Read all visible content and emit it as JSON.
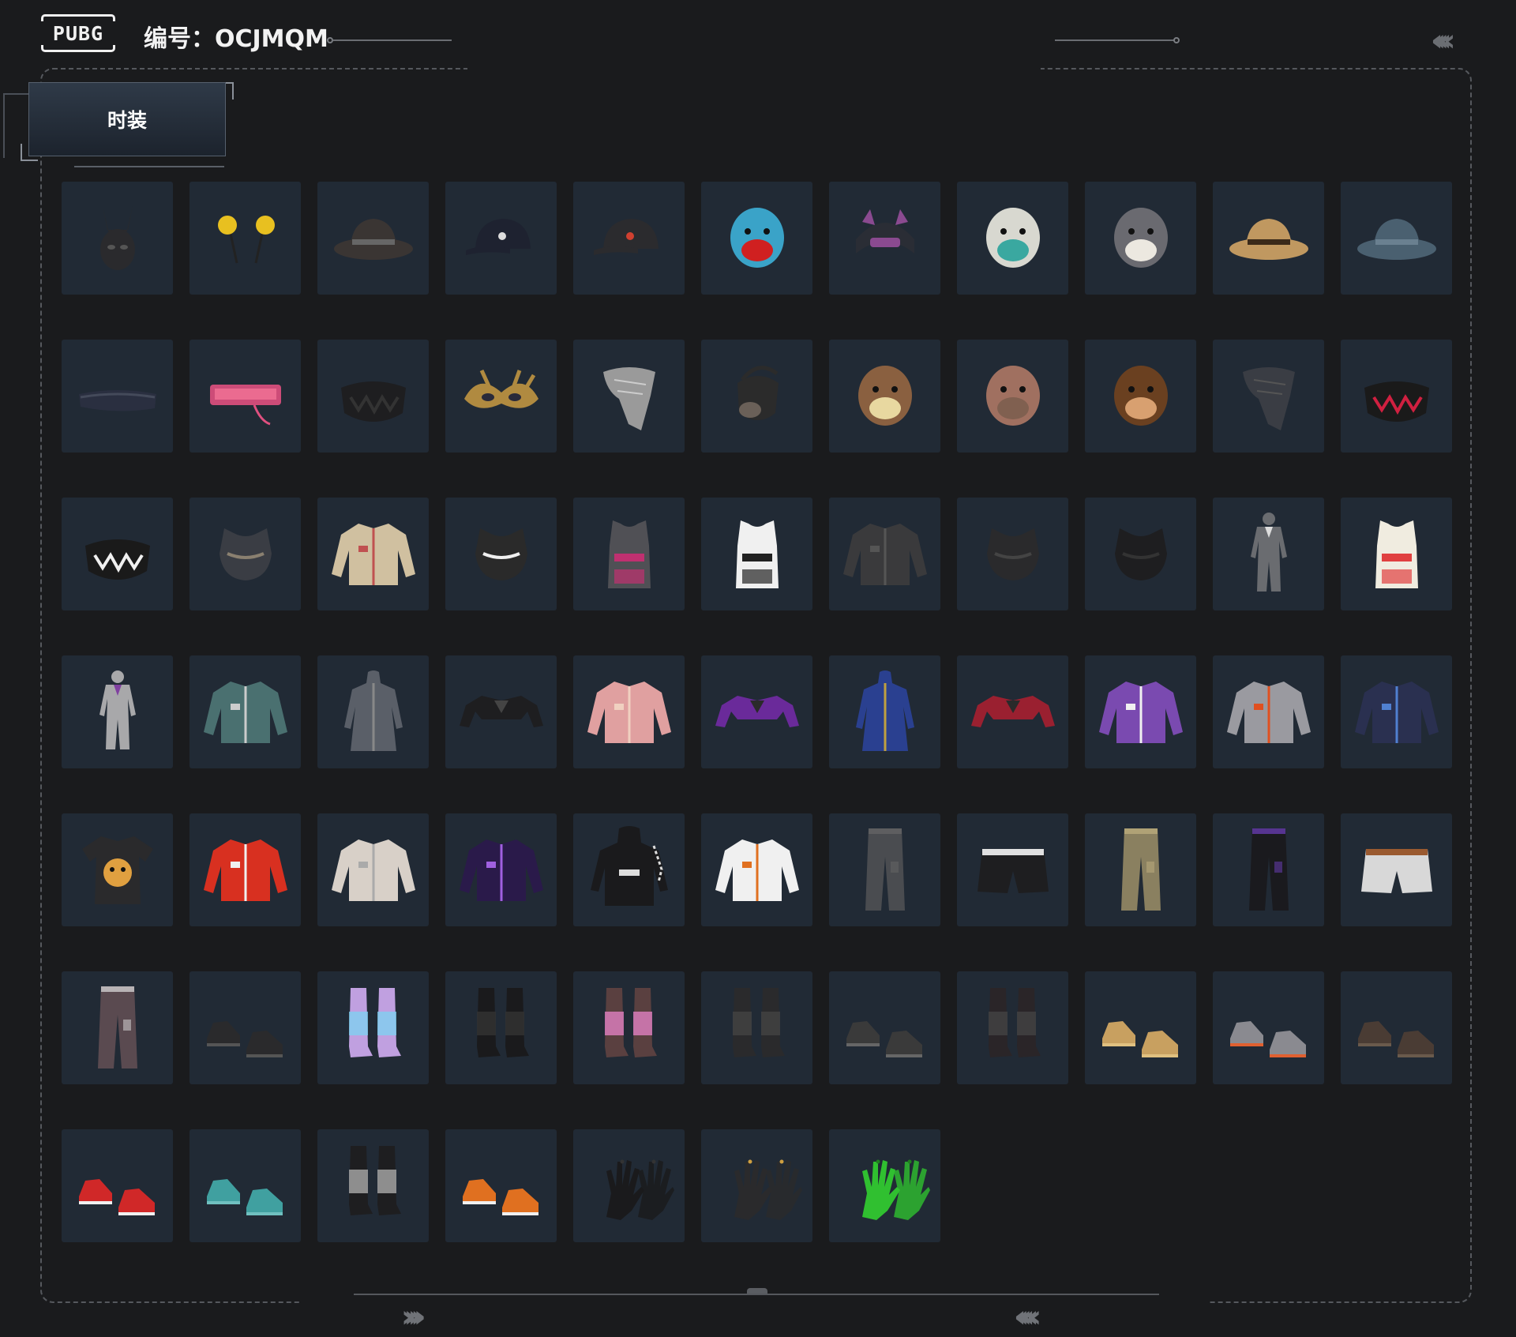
{
  "header": {
    "logo_text": "PUBG",
    "id_text": "编号：OCJMQM"
  },
  "tab": {
    "label": "时装"
  },
  "items": [
    {
      "icon": "bunny-mask-icon",
      "kind": "mask",
      "c": "#2a2a2d",
      "a": "#555"
    },
    {
      "icon": "pompom-antenna-icon",
      "kind": "antenna",
      "c": "#e8c020",
      "a": "#222"
    },
    {
      "icon": "cowboy-hat-icon",
      "kind": "hat",
      "c": "#3a3533",
      "a": "#666"
    },
    {
      "icon": "baseball-cap-icon",
      "kind": "cap",
      "c": "#1e2230",
      "a": "#ddd"
    },
    {
      "icon": "black-cap-icon",
      "kind": "cap",
      "c": "#2b2b2e",
      "a": "#d04030"
    },
    {
      "icon": "dino-head-icon",
      "kind": "head",
      "c": "#3aa3c8",
      "a": "#d02020"
    },
    {
      "icon": "cat-ear-headset-icon",
      "kind": "headset",
      "c": "#2a2d35",
      "a": "#8a4a90"
    },
    {
      "icon": "beard-mask-icon",
      "kind": "head",
      "c": "#d8d8d0",
      "a": "#3aa8a0"
    },
    {
      "icon": "husky-head-icon",
      "kind": "head",
      "c": "#6a6a70",
      "a": "#ece8e0"
    },
    {
      "icon": "bucket-hat-icon",
      "kind": "hat",
      "c": "#c09860",
      "a": "#3a2a1a"
    },
    {
      "icon": "fishing-hat-icon",
      "kind": "hat",
      "c": "#4a6070",
      "a": "#6a8090"
    },
    {
      "icon": "visor-icon",
      "kind": "visor",
      "c": "#2a2f40",
      "a": "#444a5a"
    },
    {
      "icon": "led-glasses-icon",
      "kind": "glasses",
      "c": "#e05080",
      "a": "#ff80a0"
    },
    {
      "icon": "face-mask-icon",
      "kind": "facemask",
      "c": "#1e1e20",
      "a": "#333"
    },
    {
      "icon": "gold-masquerade-icon",
      "kind": "masquerade",
      "c": "#b08a40",
      "a": "#2a2a3a"
    },
    {
      "icon": "scarf-icon",
      "kind": "scarf",
      "c": "#9a9a9a",
      "a": "#ccc"
    },
    {
      "icon": "gas-respirator-icon",
      "kind": "respirator",
      "c": "#2b2b2b",
      "a": "#6a6058"
    },
    {
      "icon": "rabbit-mask-icon",
      "kind": "head",
      "c": "#8a6040",
      "a": "#e8d8a0"
    },
    {
      "icon": "bald-head-icon",
      "kind": "head",
      "c": "#a07060",
      "a": "#806050"
    },
    {
      "icon": "monkey-mask-icon",
      "kind": "head",
      "c": "#6a4020",
      "a": "#d8a070"
    },
    {
      "icon": "bandana-icon",
      "kind": "scarf",
      "c": "#3a3d44",
      "a": "#555"
    },
    {
      "icon": "smile-mask-icon",
      "kind": "facemask",
      "c": "#1a1a1a",
      "a": "#d02040"
    },
    {
      "icon": "teeth-mask-icon",
      "kind": "facemask",
      "c": "#1a1a1a",
      "a": "#f0f0f0"
    },
    {
      "icon": "tactical-top-icon",
      "kind": "top",
      "c": "#3a3d44",
      "a": "#8a8070"
    },
    {
      "icon": "floral-shirt-icon",
      "kind": "jacket",
      "c": "#d0c0a0",
      "a": "#c05050"
    },
    {
      "icon": "halter-top-icon",
      "kind": "top",
      "c": "#2a2a2a",
      "a": "#f0f0f0"
    },
    {
      "icon": "tank-plaid-icon",
      "kind": "tank",
      "c": "#505055",
      "a": "#c03070"
    },
    {
      "icon": "white-vest-icon",
      "kind": "tank",
      "c": "#f0f0f0",
      "a": "#222"
    },
    {
      "icon": "leather-jacket-icon",
      "kind": "jacket",
      "c": "#3a3a3c",
      "a": "#555"
    },
    {
      "icon": "leather-top-icon",
      "kind": "top",
      "c": "#2a2a2c",
      "a": "#444"
    },
    {
      "icon": "strappy-top-icon",
      "kind": "top",
      "c": "#1e1e20",
      "a": "#333"
    },
    {
      "icon": "jumpsuit-icon",
      "kind": "suit",
      "c": "#6a6c70",
      "a": "#ddd"
    },
    {
      "icon": "sticker-dress-icon",
      "kind": "tank",
      "c": "#f0ece0",
      "a": "#e04040"
    },
    {
      "icon": "grey-suit-icon",
      "kind": "suit",
      "c": "#a8a8aa",
      "a": "#8040a0"
    },
    {
      "icon": "hawaiian-shirt-icon",
      "kind": "jacket",
      "c": "#4a7070",
      "a": "#ccc"
    },
    {
      "icon": "hooded-coat-icon",
      "kind": "coat",
      "c": "#5a5f68",
      "a": "#888"
    },
    {
      "icon": "black-crop-jacket-icon",
      "kind": "crop",
      "c": "#1e1e20",
      "a": "#444"
    },
    {
      "icon": "pink-jacket-icon",
      "kind": "jacket",
      "c": "#e0a0a0",
      "a": "#f0d0c0"
    },
    {
      "icon": "purple-crop-icon",
      "kind": "crop",
      "c": "#6a2a9a",
      "a": "#2a2a2a"
    },
    {
      "icon": "blue-coat-icon",
      "kind": "coat",
      "c": "#2a4090",
      "a": "#c0a040"
    },
    {
      "icon": "red-crop-icon",
      "kind": "crop",
      "c": "#9a2030",
      "a": "#2a2a2a"
    },
    {
      "icon": "purple-block-jacket-icon",
      "kind": "jacket",
      "c": "#7a4ab0",
      "a": "#f0f0f0"
    },
    {
      "icon": "silver-jacket-icon",
      "kind": "jacket",
      "c": "#9a9aa0",
      "a": "#e05020"
    },
    {
      "icon": "navy-sweater-icon",
      "kind": "jacket",
      "c": "#2a3050",
      "a": "#5080d0"
    },
    {
      "icon": "dog-tshirt-icon",
      "kind": "tshirt",
      "c": "#2a2a2c",
      "a": "#e0a040"
    },
    {
      "icon": "varsity-jacket-icon",
      "kind": "jacket",
      "c": "#d83020",
      "a": "#f0f0f0"
    },
    {
      "icon": "white-jacket-icon",
      "kind": "jacket",
      "c": "#d8d0c8",
      "a": "#aaa"
    },
    {
      "icon": "galaxy-jacket-icon",
      "kind": "jacket",
      "c": "#2a1a4a",
      "a": "#a060e0"
    },
    {
      "icon": "black-hoodie-icon",
      "kind": "hoodie",
      "c": "#1a1a1c",
      "a": "#ddd"
    },
    {
      "icon": "orange-vest-jacket-icon",
      "kind": "jacket",
      "c": "#f0f0f0",
      "a": "#e07020"
    },
    {
      "icon": "grey-jeans-icon",
      "kind": "pants",
      "c": "#4a4c50",
      "a": "#666"
    },
    {
      "icon": "black-shorts-icon",
      "kind": "shorts",
      "c": "#1e1e20",
      "a": "#e0e0e0"
    },
    {
      "icon": "camo-pants-icon",
      "kind": "pants",
      "c": "#8a8060",
      "a": "#c0b080"
    },
    {
      "icon": "black-track-pants-icon",
      "kind": "pants",
      "c": "#1a1a1e",
      "a": "#7040c0"
    },
    {
      "icon": "white-shorts-icon",
      "kind": "shorts",
      "c": "#d8d8d8",
      "a": "#9a5a30"
    },
    {
      "icon": "camo-cargo-icon",
      "kind": "pants",
      "c": "#5a4a50",
      "a": "#e0e0e0"
    },
    {
      "icon": "black-shoes-icon",
      "kind": "shoes",
      "c": "#2a2a2c",
      "a": "#555"
    },
    {
      "icon": "rainbow-legwarmers-icon",
      "kind": "boots",
      "c": "#c0a0e0",
      "a": "#80d0f0"
    },
    {
      "icon": "thigh-boots-icon",
      "kind": "boots",
      "c": "#1a1a1c",
      "a": "#333"
    },
    {
      "icon": "pink-boots-icon",
      "kind": "boots",
      "c": "#5a4040",
      "a": "#e080c0"
    },
    {
      "icon": "combat-boots-icon",
      "kind": "boots",
      "c": "#2a2a2c",
      "a": "#444"
    },
    {
      "icon": "lace-boots-icon",
      "kind": "shoes",
      "c": "#3a3a3a",
      "a": "#666"
    },
    {
      "icon": "stocking-boots-icon",
      "kind": "boots",
      "c": "#2a2528",
      "a": "#444"
    },
    {
      "icon": "tan-boots-icon",
      "kind": "shoes",
      "c": "#c8a060",
      "a": "#e0c080"
    },
    {
      "icon": "orange-sneakers-icon",
      "kind": "shoes",
      "c": "#8a8a90",
      "a": "#e06030"
    },
    {
      "icon": "paw-shoes-icon",
      "kind": "shoes",
      "c": "#4a3c34",
      "a": "#6a5a4c"
    },
    {
      "icon": "red-sneakers-icon",
      "kind": "shoes",
      "c": "#d02828",
      "a": "#f0f0f0"
    },
    {
      "icon": "teal-clogs-icon",
      "kind": "shoes",
      "c": "#40a0a0",
      "a": "#70c0c0"
    },
    {
      "icon": "fur-boots-icon",
      "kind": "boots",
      "c": "#1e1e20",
      "a": "#aaa"
    },
    {
      "icon": "orange-hightops-icon",
      "kind": "shoes",
      "c": "#e07020",
      "a": "#f0f0f0"
    },
    {
      "icon": "black-gloves-icon",
      "kind": "gloves",
      "c": "#1a1a1c",
      "a": "#333"
    },
    {
      "icon": "gold-claw-gloves-icon",
      "kind": "gloves",
      "c": "#2a2a2c",
      "a": "#d0a040"
    },
    {
      "icon": "green-gloves-icon",
      "kind": "gloves",
      "c": "#30c030",
      "a": "#208020"
    }
  ]
}
